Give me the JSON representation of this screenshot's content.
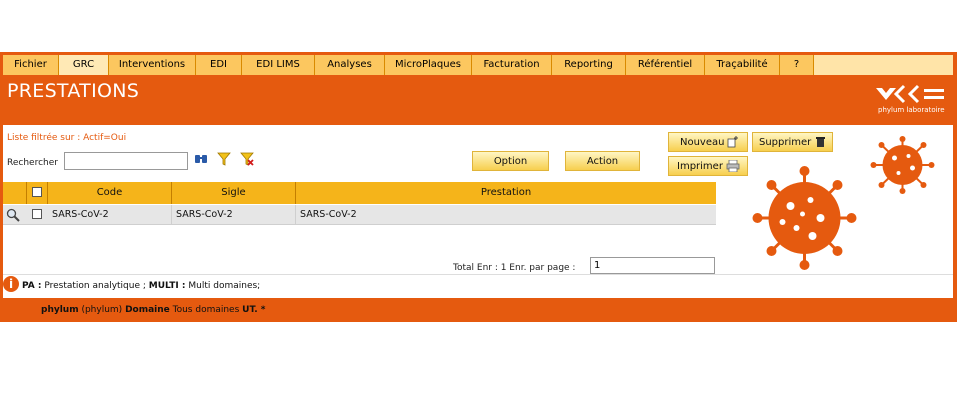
{
  "menu": [
    "Fichier",
    "GRC",
    "Interventions",
    "EDI",
    "EDI LIMS",
    "Analyses",
    "MicroPlaques",
    "Facturation",
    "Reporting",
    "Référentiel",
    "Traçabilité",
    "?"
  ],
  "header": {
    "title": "PRESTATIONS",
    "logo_text": "phylum laboratoire"
  },
  "filter": {
    "note": "Liste filtrée sur : Actif=Oui",
    "search_label": "Rechercher",
    "search_value": ""
  },
  "buttons": {
    "option": "Option",
    "action": "Action",
    "nouveau": "Nouveau",
    "supprimer": "Supprimer",
    "imprimer": "Imprimer"
  },
  "table": {
    "columns": [
      "Code",
      "Sigle",
      "Prestation"
    ],
    "rows": [
      {
        "code": "SARS-CoV-2",
        "sigle": "SARS-CoV-2",
        "prestation": "SARS-CoV-2"
      }
    ]
  },
  "paging": {
    "total_text": "Total Enr : 1  Enr. par page :",
    "per_page": "1"
  },
  "legend": {
    "pa_key": "PA :",
    "pa_value": " Prestation analytique ; ",
    "multi_key": "MULTI :",
    "multi_value": " Multi domaines;"
  },
  "footer": {
    "user_bold": "phylum",
    "user_rest": " (phylum) ",
    "domain_key": "Domaine",
    "domain_value": " Tous domaines ",
    "ut": "UT. *"
  },
  "colors": {
    "accent": "#e55a0f",
    "menu": "#fcc75f",
    "table_header": "#f5b41a"
  }
}
